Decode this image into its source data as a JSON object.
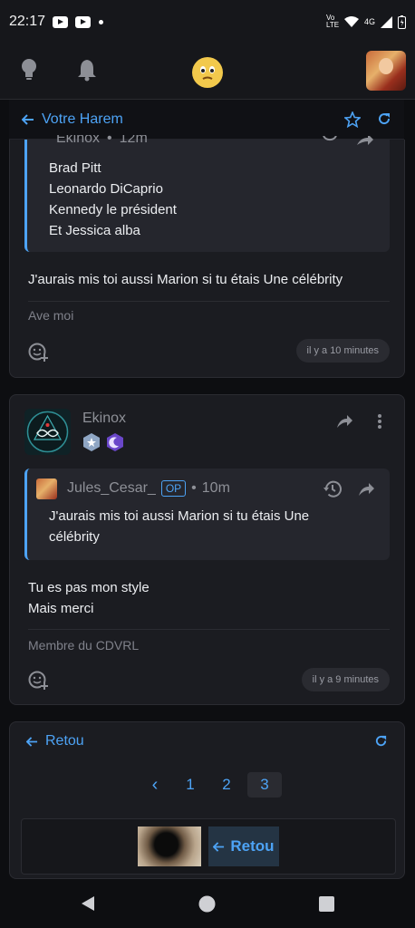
{
  "status": {
    "time": "22:17",
    "network": "Vo LTE",
    "signal": "4G"
  },
  "subheader": {
    "title": "Votre Harem"
  },
  "post1": {
    "quote_author": "Ekinox",
    "quote_time": "12m",
    "quote_lines": [
      "Brad Pitt",
      "Leonardo DiCaprio",
      "Kennedy le président",
      "Et Jessica alba"
    ],
    "body": "J'aurais mis toi aussi Marion si tu étais Une célébrity",
    "signature": "Ave moi",
    "timestamp": "il y a 10 minutes"
  },
  "post2": {
    "author": "Ekinox",
    "quote_author": "Jules_Cesar_",
    "quote_badge": "OP",
    "quote_time": "10m",
    "quote_text_line1": "J'aurais mis toi aussi Marion si tu étais Une",
    "quote_text_line2": "célébrity",
    "body_line1": "Tu es pas mon style",
    "body_line2": "Mais merci",
    "signature": "Membre du CDVRL",
    "timestamp": "il y a 9 minutes"
  },
  "pagination": {
    "back_label": "Retou",
    "pages": [
      "1",
      "2",
      "3"
    ],
    "current": "3",
    "prev_symbol": "‹",
    "footer_back_label": "Retou"
  },
  "colors": {
    "accent": "#4da3f5",
    "bg": "#0d0e11",
    "card": "#1b1c21"
  }
}
